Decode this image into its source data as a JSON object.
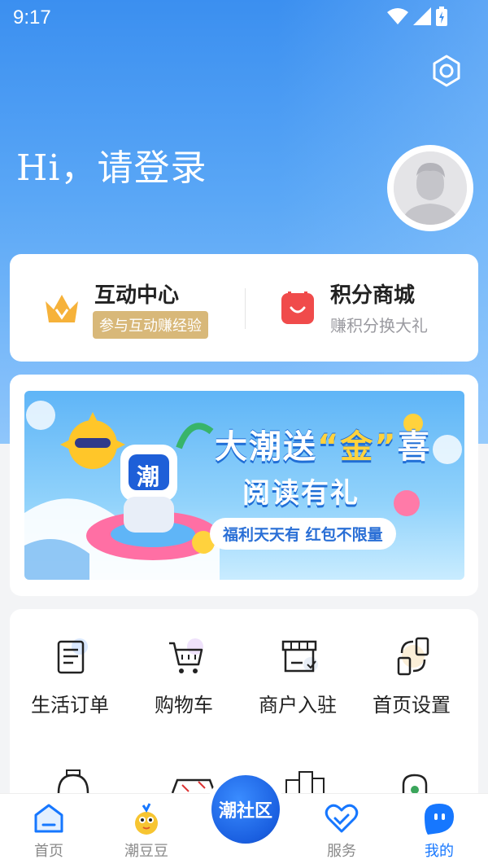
{
  "status_bar": {
    "time": "9:17"
  },
  "profile": {
    "greeting": "Hi，请登录"
  },
  "quick_cards": {
    "interaction": {
      "title": "互动中心",
      "badge": "参与互动赚经验"
    },
    "points_mall": {
      "title": "积分商城",
      "subtitle": "赚积分换大礼"
    }
  },
  "banner": {
    "line1_pre": "大潮送",
    "line1_gold": "“金”",
    "line1_post": "喜",
    "line2": "阅读有礼",
    "pill": "福利天天有 红包不限量",
    "mascot_char": "潮"
  },
  "grid": {
    "items": [
      {
        "label": "生活订单",
        "icon": "receipt-icon"
      },
      {
        "label": "购物车",
        "icon": "cart-icon"
      },
      {
        "label": "商户入驻",
        "icon": "store-icon"
      },
      {
        "label": "首页设置",
        "icon": "phone-settings-icon"
      }
    ]
  },
  "tab_bar": {
    "items": [
      {
        "label": "首页",
        "icon": "home-icon"
      },
      {
        "label": "潮豆豆",
        "icon": "mascot-icon"
      },
      {
        "label": "服务",
        "icon": "heart-icon"
      },
      {
        "label": "我的",
        "icon": "profile-icon"
      }
    ],
    "center": "潮社区",
    "active_index": 3
  },
  "colors": {
    "hero_top": "#3b8ff0",
    "accent_blue": "#1677ff",
    "badge_gold": "#d8b879",
    "mall_red": "#f04b4b"
  }
}
